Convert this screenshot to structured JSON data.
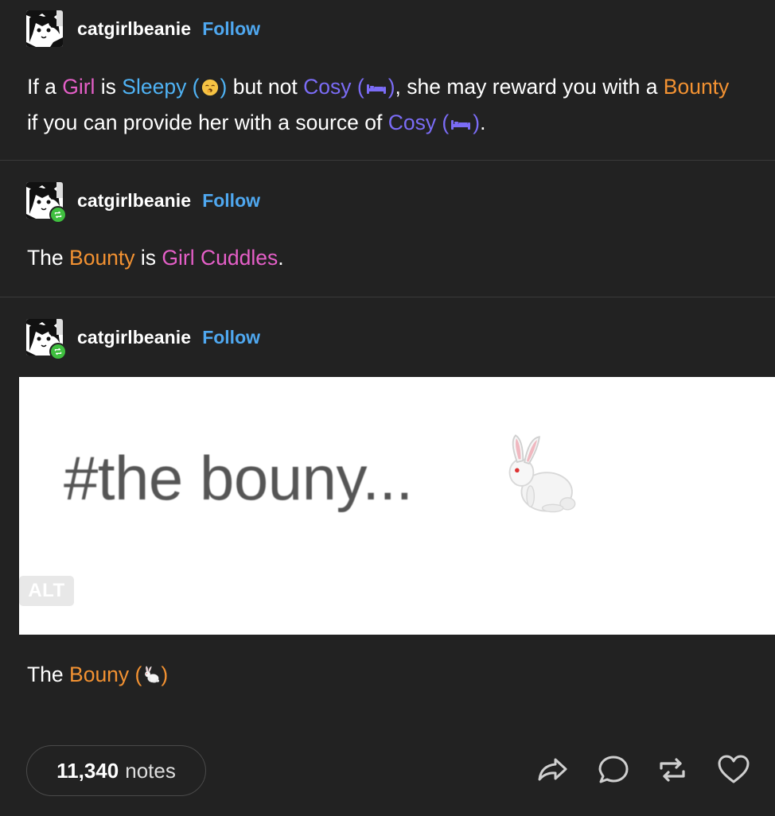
{
  "posts": [
    {
      "username": "catgirlbeanie",
      "follow_label": "Follow",
      "text": {
        "p1": "If a ",
        "girl": "Girl",
        "p2": " is ",
        "sleepy": "Sleepy (",
        "sleepy_close": ")",
        "p3": " but not ",
        "cosy1": "Cosy (",
        "cosy1_close": ")",
        "p4": ", she may reward you with a ",
        "bounty": "Bounty",
        "p5": " if you can provide her with a source of ",
        "cosy2": "Cosy (",
        "cosy2_close": ")",
        "p6": "."
      }
    },
    {
      "username": "catgirlbeanie",
      "follow_label": "Follow",
      "text": {
        "p1": "The ",
        "bounty": "Bounty",
        "p2": " is ",
        "cuddles": "Girl Cuddles",
        "p3": "."
      }
    },
    {
      "username": "catgirlbeanie",
      "follow_label": "Follow",
      "image": {
        "hashtag": "#the bouny...",
        "alt_label": "ALT"
      },
      "text": {
        "p1": "The ",
        "bouny": "Bouny (",
        "bouny_close": ")"
      }
    }
  ],
  "footer": {
    "notes_count": "11,340",
    "notes_label": "notes",
    "actions": [
      "share-icon",
      "reply-icon",
      "reblog-icon",
      "like-icon"
    ]
  },
  "colors": {
    "background": "#222222",
    "follow": "#4fa8f0",
    "pink": "#e55fc8",
    "blue": "#4fb3f5",
    "purple": "#7b6cf6",
    "orange": "#f39232",
    "reblog_badge": "#3fbf3f"
  }
}
